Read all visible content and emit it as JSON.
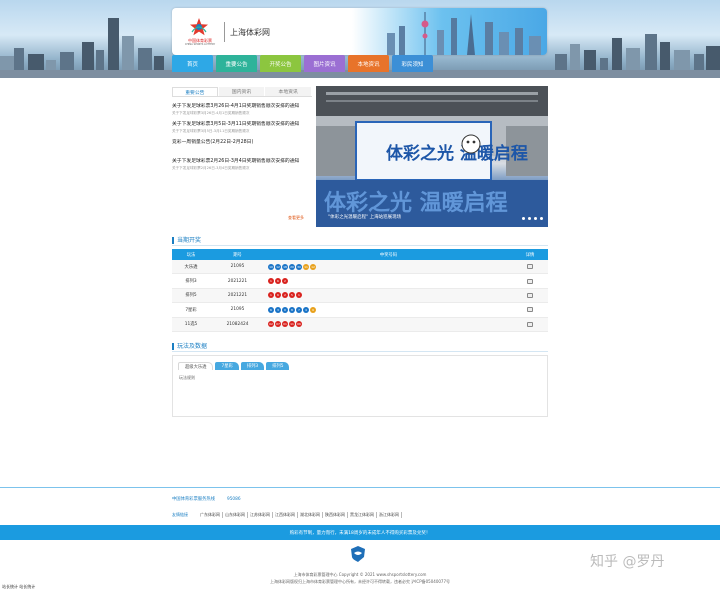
{
  "header": {
    "logo_cn": "中国体育彩票",
    "logo_en": "CHINA SPORTS LOTTERY",
    "site_name": "上海体彩网"
  },
  "nav": [
    {
      "label": "首页",
      "color": "#2ea8e6"
    },
    {
      "label": "重要公告",
      "color": "#2eb39a"
    },
    {
      "label": "开奖公告",
      "color": "#8cc63f"
    },
    {
      "label": "图片资讯",
      "color": "#9b6fd3"
    },
    {
      "label": "本地资讯",
      "color": "#e8732a"
    },
    {
      "label": "彩民须知",
      "color": "#3c8fd6"
    }
  ],
  "announcements": {
    "tabs": [
      "重要公告",
      "国内资讯",
      "本地资讯"
    ],
    "items": [
      {
        "title": "关于下发足球彩票3月26日-4月1日奖期销售顺次安排的通知",
        "sub": "关于下发足球彩票3月26日-4月1日奖期销售顺次"
      },
      {
        "title": "关于下发足球彩票3月5日-3月11日奖期销售顺次安排的通知",
        "sub": "关于下发足球彩票3月5日-3月11日奖期销售顺次"
      },
      {
        "title": "竞彩一周销量公告(2月22日-2月28日)",
        "sub": ""
      },
      {
        "title": "关于下发足球彩票2月26日-3月4日奖期销售顺次安排的通知",
        "sub": "关于下发足球彩票2月26日-3月4日奖期销售顺次"
      }
    ],
    "more": "查看更多"
  },
  "banner": {
    "caption": "\"体彩之光温暖启程\" 上海站巡展现场",
    "headline": "体彩之光 温暖启程"
  },
  "draw_section": {
    "title": "当期开奖",
    "headers": [
      "玩法",
      "期号",
      "中奖号码",
      "详情"
    ],
    "rows": [
      {
        "game": "大乐透",
        "issue": "21095",
        "balls": [
          [
            "10",
            "b"
          ],
          [
            "12",
            "b"
          ],
          [
            "18",
            "b"
          ],
          [
            "20",
            "b"
          ],
          [
            "30",
            "b"
          ],
          [
            "11",
            "y"
          ],
          [
            "12",
            "y"
          ]
        ]
      },
      {
        "game": "排列3",
        "issue": "2021221",
        "balls": [
          [
            "1",
            "r"
          ],
          [
            "6",
            "r"
          ],
          [
            "2",
            "r"
          ]
        ]
      },
      {
        "game": "排列5",
        "issue": "2021221",
        "balls": [
          [
            "1",
            "r"
          ],
          [
            "6",
            "r"
          ],
          [
            "2",
            "r"
          ],
          [
            "5",
            "r"
          ],
          [
            "1",
            "r"
          ]
        ]
      },
      {
        "game": "7星彩",
        "issue": "21095",
        "balls": [
          [
            "6",
            "b"
          ],
          [
            "3",
            "b"
          ],
          [
            "0",
            "b"
          ],
          [
            "8",
            "b"
          ],
          [
            "7",
            "b"
          ],
          [
            "4",
            "b"
          ],
          [
            "9",
            "y"
          ]
        ]
      },
      {
        "game": "11选5",
        "issue": "21082424",
        "balls": [
          [
            "02",
            "r"
          ],
          [
            "07",
            "r"
          ],
          [
            "01",
            "r"
          ],
          [
            "11",
            "r"
          ],
          [
            "06",
            "r"
          ]
        ]
      }
    ]
  },
  "data_section": {
    "title": "玩法及数据",
    "tabs": [
      "超级大乐透",
      "7星彩",
      "排列3",
      "排列5"
    ],
    "body": "玩法规则"
  },
  "footer": {
    "partner1": "中国体育彩票服务热线",
    "partner2": "95086",
    "links_label": "友情链接",
    "links": [
      "广东体彩网",
      "山东体彩网",
      "江苏体彩网",
      "江西体彩网",
      "湖北体彩网",
      "陕西体彩网",
      "黑龙江体彩网",
      "浙江体彩网"
    ],
    "notice": "购彩有节制，量力而行，未满18周岁的未成年人不得购买彩票及兑奖！",
    "copy1": "上海市体育彩票管理中心 Copyright © 2021 www.shsportslottery.com",
    "copy2": "上海体彩网版权归上海市体育彩票管理中心所有，未经许可不得转载，违者必究 沪ICP备05040077号",
    "corner": "站长统计 站长统计",
    "watermark": "知乎 @罗丹"
  }
}
